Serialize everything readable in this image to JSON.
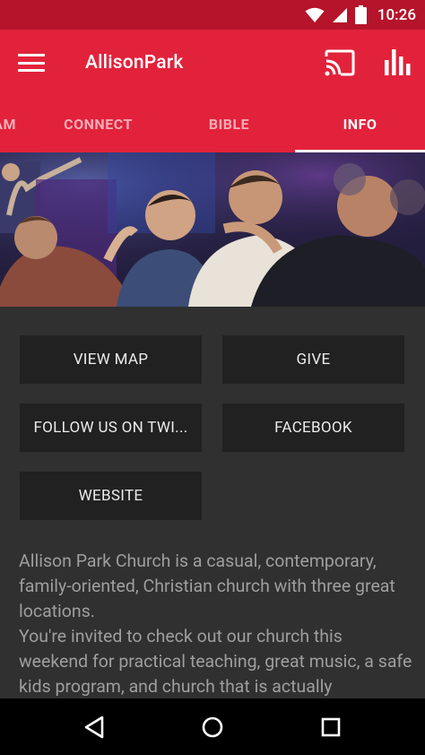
{
  "status_bar": {
    "time": "10:26",
    "icons": [
      "wifi-icon",
      "cell-signal-icon",
      "battery-icon"
    ]
  },
  "app_bar": {
    "title": "AllisonPark",
    "icons": [
      "menu-icon",
      "cast-icon",
      "bar-chart-icon"
    ]
  },
  "tabs": [
    {
      "label": "AM",
      "active": false
    },
    {
      "label": "CONNECT",
      "active": false
    },
    {
      "label": "BIBLE",
      "active": false
    },
    {
      "label": "INFO",
      "active": true
    }
  ],
  "hero": {
    "icon": "worship-photo"
  },
  "buttons": {
    "view_map": "VIEW MAP",
    "give": "GIVE",
    "follow_twitter": "FOLLOW US ON TWI...",
    "facebook": "FACEBOOK",
    "website": "WEBSITE"
  },
  "description": {
    "line1": "Allison Park Church is a casual, contemporary, family-oriented, Christian church with three great locations.",
    "line2": "You're invited to check out our church this weekend for practical teaching, great music, a safe kids program, and church that is actually"
  },
  "nav_bar": {
    "icons": [
      "back-icon",
      "home-icon",
      "recents-icon"
    ]
  },
  "colors": {
    "primary": "#e2223b",
    "status_bar": "#b5142a",
    "background": "#303030",
    "button": "#212121",
    "body_text": "#9e9e9e"
  }
}
